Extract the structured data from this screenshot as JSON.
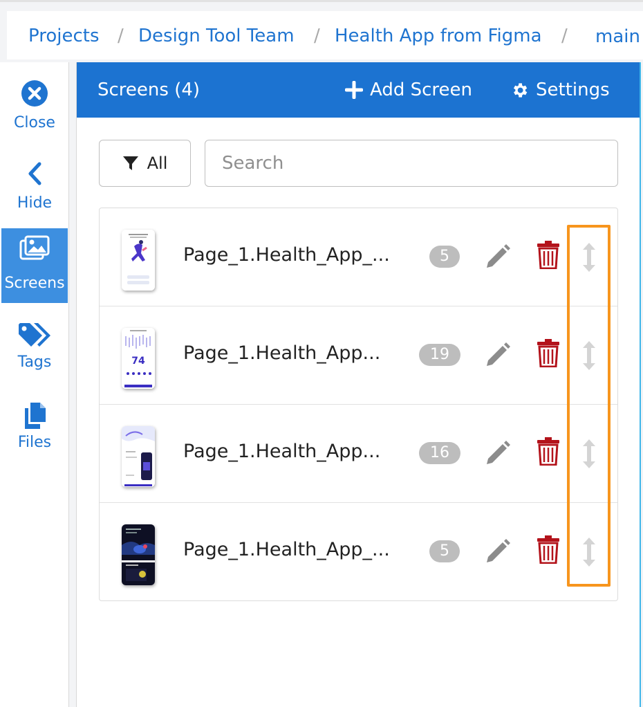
{
  "breadcrumb": {
    "items": [
      "Projects",
      "Design Tool Team",
      "Health App from Figma",
      "main"
    ],
    "separator": "/"
  },
  "sidebar": {
    "items": [
      {
        "label": "Close",
        "icon": "close-circle-icon"
      },
      {
        "label": "Hide",
        "icon": "chevron-left-icon"
      },
      {
        "label": "Screens",
        "icon": "images-icon",
        "active": true
      },
      {
        "label": "Tags",
        "icon": "tags-icon"
      },
      {
        "label": "Files",
        "icon": "files-icon"
      }
    ]
  },
  "panel": {
    "title": "Screens (4)",
    "add_label": "Add Screen",
    "settings_label": "Settings"
  },
  "filter": {
    "label": "All",
    "search_placeholder": "Search"
  },
  "screens": [
    {
      "name": "Page_1.Health_App_...",
      "count": "5"
    },
    {
      "name": "Page_1.Health_App...",
      "count": "19"
    },
    {
      "name": "Page_1.Health_App...",
      "count": "16"
    },
    {
      "name": "Page_1.Health_App_...",
      "count": "5"
    }
  ],
  "thumbnails": {
    "row2_number": "74"
  },
  "colors": {
    "accent": "#1c73d1",
    "link": "#1f74d0",
    "active_sidebar": "#3d8fe0",
    "delete": "#b3131b",
    "badge": "#bdbdbd",
    "highlight": "#f7951d"
  }
}
